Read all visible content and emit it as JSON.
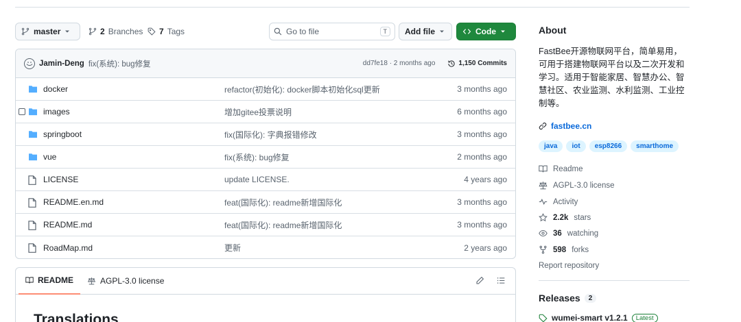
{
  "toolbar": {
    "branch": "master",
    "branches_count": "2",
    "branches_label": "Branches",
    "tags_count": "7",
    "tags_label": "Tags",
    "search_placeholder": "Go to file",
    "search_shortcut": "T",
    "add_file": "Add file",
    "code": "Code"
  },
  "commit": {
    "author": "Jamin-Deng",
    "message": "fix(系统): bug修复",
    "sha_time": "dd7fe18 · 2 months ago",
    "commits": "1,150 Commits"
  },
  "files": [
    {
      "name": "docker",
      "type": "folder",
      "message": "refactor(初始化): docker脚本初始化sql更新",
      "age": "3 months ago"
    },
    {
      "name": "images",
      "type": "folder",
      "message": "增加gitee投票说明",
      "age": "6 months ago"
    },
    {
      "name": "springboot",
      "type": "folder",
      "message": "fix(国际化): 字典报错修改",
      "age": "3 months ago"
    },
    {
      "name": "vue",
      "type": "folder",
      "message": "fix(系统): bug修复",
      "age": "2 months ago"
    },
    {
      "name": "LICENSE",
      "type": "file",
      "message": "update LICENSE.",
      "age": "4 years ago"
    },
    {
      "name": "README.en.md",
      "type": "file",
      "message": "feat(国际化): readme新增国际化",
      "age": "3 months ago"
    },
    {
      "name": "README.md",
      "type": "file",
      "message": "feat(国际化): readme新增国际化",
      "age": "3 months ago"
    },
    {
      "name": "RoadMap.md",
      "type": "file",
      "message": "更新",
      "age": "2 years ago"
    }
  ],
  "readme": {
    "tab_readme": "README",
    "tab_license": "AGPL-3.0 license",
    "heading": "Translations"
  },
  "sidebar": {
    "about_title": "About",
    "description": "FastBee开源物联网平台，简单易用，可用于搭建物联网平台以及二次开发和学习。适用于智能家居、智慧办公、智慧社区、农业监测、水利监测、工业控制等。",
    "website": "fastbee.cn",
    "topics": [
      "java",
      "iot",
      "esp8266",
      "smarthome"
    ],
    "readme": "Readme",
    "license": "AGPL-3.0 license",
    "activity": "Activity",
    "stars_count": "2.2k",
    "stars_label": "stars",
    "watching_count": "36",
    "watching_label": "watching",
    "forks_count": "598",
    "forks_label": "forks",
    "report": "Report repository",
    "releases_title": "Releases",
    "releases_count": "2",
    "release_name": "wumei-smart v1.2.1",
    "release_badge": "Latest"
  },
  "colors": {
    "accent": "#0969da",
    "green": "#1f883d",
    "folder": "#54aeff",
    "muted": "#59636e"
  }
}
